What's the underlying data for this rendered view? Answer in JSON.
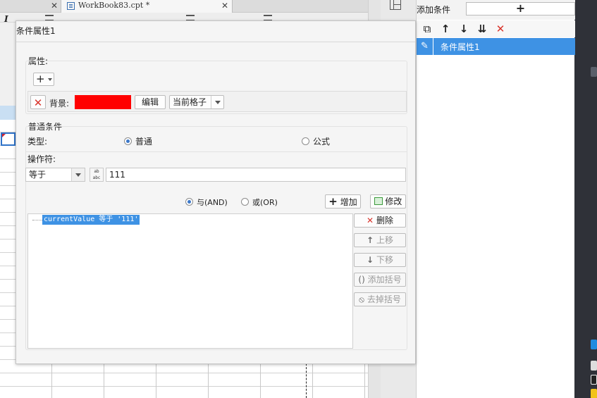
{
  "background_app": {
    "tab_title": "WorkBook83.cpt *",
    "italic_glyph": "I",
    "close_glyph": "✕"
  },
  "right_panel": {
    "title": "添加条件",
    "add_glyph": "+",
    "tools": {
      "copy": "⧉",
      "up": "↑",
      "down": "↓",
      "bottom": "⇊",
      "delete": "✕"
    },
    "items": [
      {
        "label": "条件属性1",
        "icon": "✎"
      }
    ]
  },
  "dialog": {
    "title": "条件属性1",
    "attributes": {
      "section_label": "属性:",
      "add_glyph": "+",
      "background_label": "背景:",
      "background_color": "#ff0000",
      "edit_button": "编辑",
      "scope_value": "当前格子",
      "delete_glyph": "✕"
    },
    "condition": {
      "section_label": "普通条件",
      "type_label": "类型:",
      "type_options": [
        "普通",
        "公式"
      ],
      "type_selected": "普通",
      "operator_label": "操作符:",
      "operator_value": "等于",
      "value_text": "111",
      "logic_options": [
        "与(AND)",
        "或(OR)"
      ],
      "logic_selected": "与(AND)",
      "add_button": "增加",
      "modify_button": "修改",
      "list_items": [
        "currentValue 等于 '111'"
      ],
      "side_buttons": {
        "delete": "删除",
        "move_up": "上移",
        "move_down": "下移",
        "add_bracket": "添加括号",
        "remove_bracket": "去掉括号"
      }
    }
  }
}
